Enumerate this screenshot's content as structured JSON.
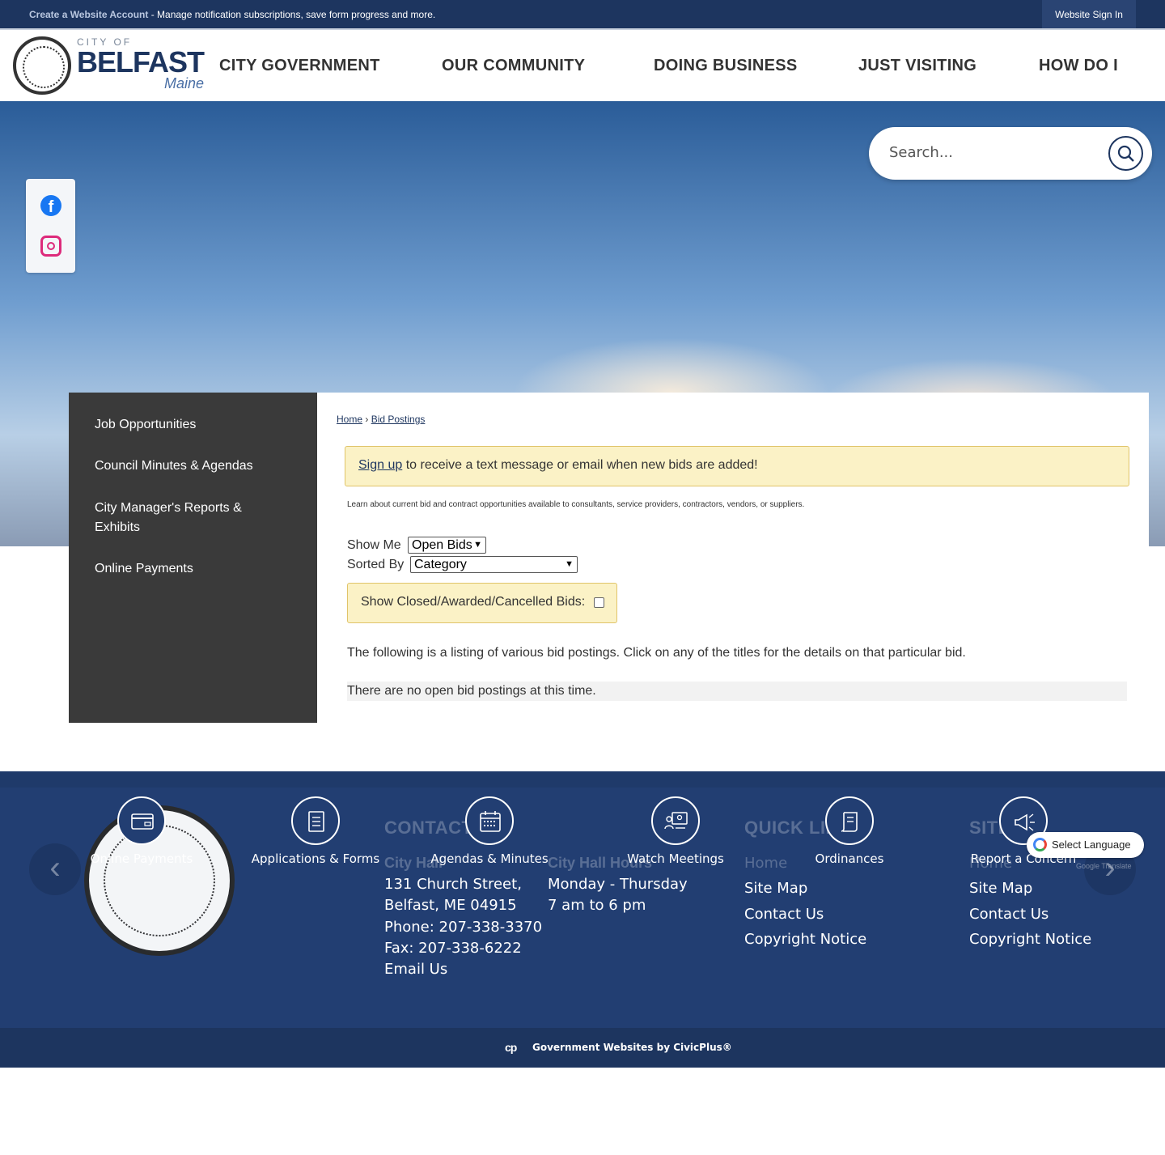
{
  "topbar": {
    "create_account": "Create a Website Account",
    "message": " - Manage notification subscriptions, save form progress and more.",
    "sign_in": "Website Sign In"
  },
  "logo": {
    "city_of": "CITY OF",
    "name": "BELFAST",
    "state": "Maine"
  },
  "nav": [
    {
      "label": "CITY GOVERNMENT"
    },
    {
      "label": "OUR COMMUNITY"
    },
    {
      "label": "DOING BUSINESS"
    },
    {
      "label": "JUST VISITING"
    },
    {
      "label": "HOW DO I"
    }
  ],
  "search": {
    "placeholder": "Search..."
  },
  "sidenav": [
    {
      "label": "Job Opportunities"
    },
    {
      "label": "Council Minutes & Agendas"
    },
    {
      "label": "City Manager's Reports & Exhibits"
    },
    {
      "label": "Online Payments"
    }
  ],
  "breadcrumb": {
    "home": "Home",
    "sep": " › ",
    "current": "Bid Postings"
  },
  "alert": {
    "link": "Sign up",
    "text": " to receive a text message or email when new bids are added!"
  },
  "description": "Learn about current bid and contract opportunities available to consultants, service providers, contractors, vendors, or suppliers.",
  "filters": {
    "show_me_label": "Show Me",
    "show_me_value": "Open Bids",
    "sorted_by_label": "Sorted By",
    "sorted_by_value": "Category",
    "closed_label": "Show Closed/Awarded/Cancelled Bids:"
  },
  "listing_text": "The following is a listing of various bid postings. Click on any of the titles for the details on that particular bid.",
  "no_bids": "There are no open bid postings at this time.",
  "footer": {
    "contact_heading": "CONTACT US",
    "city_hall": "City Hall",
    "address_1": "131 Church Street,",
    "address_2": "Belfast, ME 04915",
    "phone": "Phone: 207-338-3370",
    "fax": "Fax: 207-338-6222",
    "email": "Email Us",
    "hours_heading": "City Hall Hours",
    "hours_days": "Monday - Thursday",
    "hours_time": "7 am to 6 pm",
    "quick_links_heading": "QUICK LINKS",
    "quick_links": [
      "Home",
      "Site Map",
      "Contact Us",
      "Copyright Notice"
    ],
    "site_heading": "SITE",
    "site_links": [
      "Home",
      "Site Map",
      "Contact Us",
      "Copyright Notice"
    ]
  },
  "quick_icons": [
    {
      "label": "Online Payments",
      "icon": "credit-card-icon"
    },
    {
      "label": "Applications & Forms",
      "icon": "document-icon"
    },
    {
      "label": "Agendas & Minutes",
      "icon": "calendar-icon"
    },
    {
      "label": "Watch Meetings",
      "icon": "video-meeting-icon"
    },
    {
      "label": "Ordinances",
      "icon": "scroll-icon"
    },
    {
      "label": "Report a Concern",
      "icon": "megaphone-icon"
    }
  ],
  "language": {
    "label": "Select Language",
    "powered": "Google Translate"
  },
  "bottom": {
    "credit": "Government Websites by CivicPlus®",
    "logo": "cp"
  },
  "colors": {
    "navy": "#1d355f",
    "footer": "#223e72",
    "alert_bg": "#fbf2c6",
    "sidenav": "#3a3a3a"
  }
}
